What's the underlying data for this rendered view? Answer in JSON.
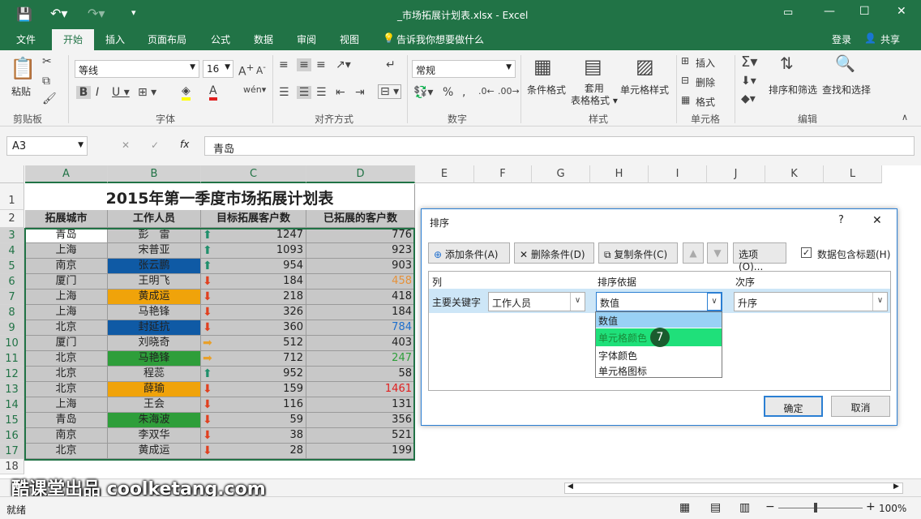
{
  "window": {
    "title": "_市场拓展计划表.xlsx - Excel"
  },
  "tabs": [
    "文件",
    "开始",
    "插入",
    "页面布局",
    "公式",
    "数据",
    "审阅",
    "视图"
  ],
  "tell_me": "告诉我你想要做什么",
  "login": "登录",
  "share": "共享",
  "ribbon": {
    "paste": "粘贴",
    "clipboard": "剪贴板",
    "font_name": "等线",
    "font_size": "16",
    "font_group": "字体",
    "align_group": "对齐方式",
    "number_format": "常规",
    "number_group": "数字",
    "cond_format": "条件格式",
    "table_format": "套用\n表格格式",
    "cell_style": "单元格样式",
    "style_group": "样式",
    "insert": "插入",
    "delete": "删除",
    "format": "格式",
    "cells_group": "单元格",
    "sort_filter": "排序和筛选",
    "find_select": "查找和选择",
    "edit_group": "编辑"
  },
  "formula_bar": {
    "name_box": "A3",
    "content": "青岛"
  },
  "columns": [
    "A",
    "B",
    "C",
    "D",
    "E",
    "F",
    "G",
    "H",
    "I",
    "J",
    "K",
    "L"
  ],
  "sheet": {
    "title": "2015年第一季度市场拓展计划表",
    "headers": [
      "拓展城市",
      "工作人员",
      "目标拓展客户数",
      "已拓展的客户数"
    ],
    "rows": [
      {
        "n": "3",
        "city": "青岛",
        "person": "彭　雷",
        "target": "1247",
        "done": "776",
        "fill": "",
        "arrow": "up",
        "dcolor": "#222"
      },
      {
        "n": "4",
        "city": "上海",
        "person": "宋普亚",
        "target": "1093",
        "done": "923",
        "fill": "",
        "arrow": "up",
        "dcolor": "#222"
      },
      {
        "n": "5",
        "city": "南京",
        "person": "张云鹏",
        "target": "954",
        "done": "903",
        "fill": "#0f5aa5",
        "arrow": "up",
        "dcolor": "#222"
      },
      {
        "n": "6",
        "city": "厦门",
        "person": "王明飞",
        "target": "184",
        "done": "458",
        "fill": "",
        "arrow": "down",
        "dcolor": "#e69138"
      },
      {
        "n": "7",
        "city": "上海",
        "person": "黄成运",
        "target": "218",
        "done": "418",
        "fill": "#f0a30a",
        "arrow": "down",
        "dcolor": "#222"
      },
      {
        "n": "8",
        "city": "上海",
        "person": "马艳锋",
        "target": "326",
        "done": "184",
        "fill": "",
        "arrow": "down",
        "dcolor": "#222"
      },
      {
        "n": "9",
        "city": "北京",
        "person": "封延抗",
        "target": "360",
        "done": "784",
        "fill": "#0f5aa5",
        "arrow": "down",
        "dcolor": "#1e6fcc"
      },
      {
        "n": "10",
        "city": "厦门",
        "person": "刘晓奇",
        "target": "512",
        "done": "403",
        "fill": "",
        "arrow": "right",
        "dcolor": "#222"
      },
      {
        "n": "11",
        "city": "北京",
        "person": "马艳锋",
        "target": "712",
        "done": "247",
        "fill": "#2e9e3a",
        "arrow": "right",
        "dcolor": "#2e9e3a"
      },
      {
        "n": "12",
        "city": "北京",
        "person": "程蕊",
        "target": "952",
        "done": "58",
        "fill": "",
        "arrow": "up",
        "dcolor": "#222"
      },
      {
        "n": "13",
        "city": "北京",
        "person": "薛瑜",
        "target": "159",
        "done": "1461",
        "fill": "#f0a30a",
        "arrow": "down",
        "dcolor": "#e02020"
      },
      {
        "n": "14",
        "city": "上海",
        "person": "王会",
        "target": "116",
        "done": "131",
        "fill": "",
        "arrow": "down",
        "dcolor": "#222"
      },
      {
        "n": "15",
        "city": "青岛",
        "person": "朱海波",
        "target": "59",
        "done": "356",
        "fill": "#2e9e3a",
        "arrow": "down",
        "dcolor": "#222"
      },
      {
        "n": "16",
        "city": "南京",
        "person": "李双华",
        "target": "38",
        "done": "521",
        "fill": "",
        "arrow": "down",
        "dcolor": "#222"
      },
      {
        "n": "17",
        "city": "北京",
        "person": "黄成运",
        "target": "28",
        "done": "199",
        "fill": "",
        "arrow": "down",
        "dcolor": "#222"
      }
    ]
  },
  "dialog": {
    "title": "排序",
    "help": "?",
    "close": "✕",
    "add_level": "添加条件(A)",
    "delete_level": "删除条件(D)",
    "copy_level": "复制条件(C)",
    "options": "选项(O)...",
    "header_check": "数据包含标题(H)",
    "col_header": "列",
    "sort_on_header": "排序依据",
    "order_header": "次序",
    "primary_key": "主要关键字",
    "key_value": "工作人员",
    "sort_on_value": "数值",
    "order_value": "升序",
    "options_list": [
      "数值",
      "单元格颜色",
      "字体颜色",
      "单元格图标"
    ],
    "step_badge": "7",
    "ok": "确定",
    "cancel": "取消"
  },
  "status": {
    "ready": "就绪",
    "zoom": "100%"
  },
  "watermark": "酷课堂出品 coolketang.com",
  "icons": {
    "up": "⬆",
    "down": "⬇",
    "right": "➡"
  },
  "arrow_colors": {
    "up": "#1f8f6b",
    "down": "#e0401f",
    "right": "#e8a02a"
  }
}
